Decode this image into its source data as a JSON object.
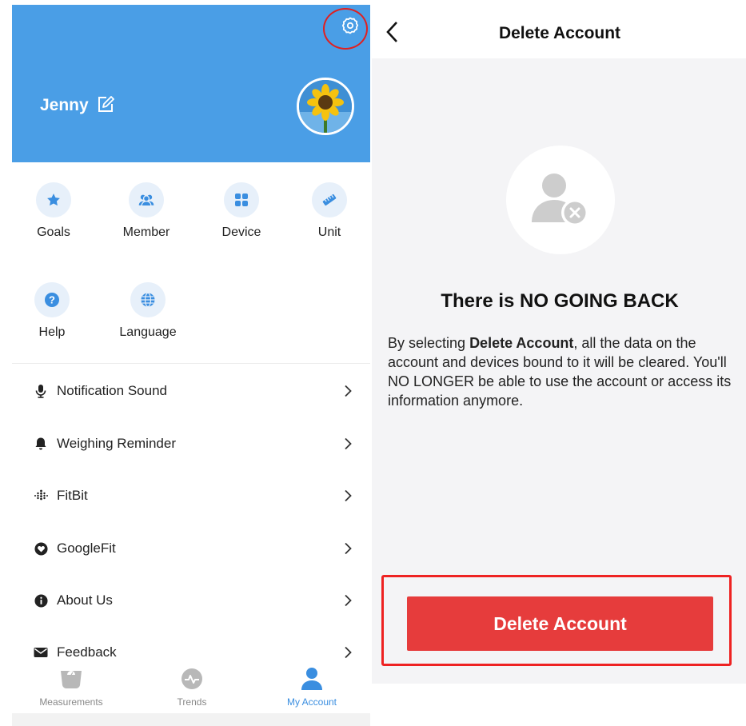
{
  "profile": {
    "name": "Jenny",
    "header_color": "#4a9ee6"
  },
  "quick_actions": [
    {
      "label": "Goals",
      "icon": "star-icon"
    },
    {
      "label": "Member",
      "icon": "members-icon"
    },
    {
      "label": "Device",
      "icon": "device-grid-icon"
    },
    {
      "label": "Unit",
      "icon": "ruler-icon"
    },
    {
      "label": "Help",
      "icon": "help-icon"
    },
    {
      "label": "Language",
      "icon": "globe-icon"
    }
  ],
  "menu": [
    {
      "label": "Notification Sound",
      "icon": "microphone-icon"
    },
    {
      "label": "Weighing Reminder",
      "icon": "bell-icon"
    },
    {
      "label": "FitBit",
      "icon": "fitbit-icon"
    },
    {
      "label": "GoogleFit",
      "icon": "googlefit-icon"
    },
    {
      "label": "About Us",
      "icon": "info-icon"
    },
    {
      "label": "Feedback",
      "icon": "mail-icon"
    }
  ],
  "tabs": [
    {
      "label": "Measurements",
      "icon": "scale-icon",
      "active": false
    },
    {
      "label": "Trends",
      "icon": "trends-icon",
      "active": false
    },
    {
      "label": "My Account",
      "icon": "person-icon",
      "active": true
    }
  ],
  "delete_page": {
    "title": "Delete Account",
    "warning_title": "There is NO GOING BACK",
    "warning_pre": "By selecting ",
    "warning_bold": "Delete Account",
    "warning_post": ", all the data on the account and devices bound to it will be cleared. You'll NO LONGER be able to use the account or access its information anymore.",
    "button_label": "Delete Account",
    "button_color": "#e63c3c"
  },
  "accent_color": "#3a8ee0"
}
